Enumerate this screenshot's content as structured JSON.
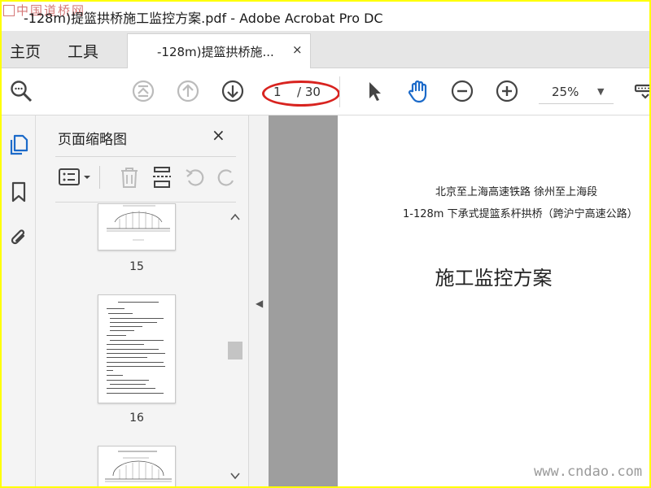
{
  "watermark_top": "中国道桥网",
  "window": {
    "title": "-128m)提篮拱桥施工监控方案.pdf - Adobe Acrobat Pro DC"
  },
  "tabs": {
    "home": "主页",
    "tools": "工具",
    "document": "-128m)提篮拱桥施...",
    "close": "×"
  },
  "toolbar": {
    "page_current": "1",
    "page_total": "/ 30",
    "zoom": "25%",
    "annotation_color": "#d8231f",
    "icons": [
      "search-icon",
      "first-page-icon",
      "prev-page-icon",
      "next-page-icon",
      "select-arrow-icon",
      "hand-tool-icon",
      "zoom-out-icon",
      "zoom-in-icon",
      "zoom-caret-icon",
      "more-tools-icon"
    ]
  },
  "accent_color": "#1b6ac9",
  "thumbnails_panel": {
    "title": "页面缩略图",
    "close": "×",
    "pages": [
      {
        "label": "15"
      },
      {
        "label": "16"
      },
      {
        "label": ""
      }
    ]
  },
  "document": {
    "line1": "北京至上海高速铁路    徐州至上海段",
    "line2": "1-128m 下承式提篮系杆拱桥（跨沪宁高速公路）",
    "heading": "施工监控方案"
  },
  "watermark_bottom": "www.cndao.com"
}
